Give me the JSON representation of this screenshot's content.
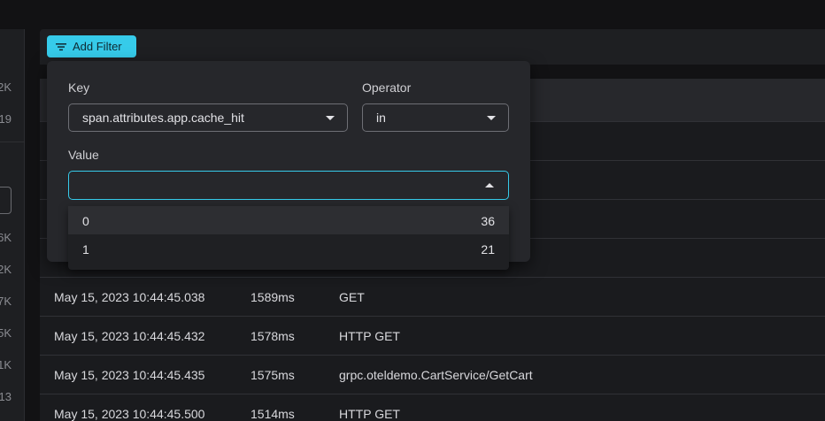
{
  "sidebar": {
    "counts": [
      "2K",
      "19",
      "6K",
      "2K",
      "7K",
      "5K",
      "1K",
      "13"
    ]
  },
  "filter_bar": {
    "add_filter_label": "Add Filter"
  },
  "filter_popover": {
    "key_label": "Key",
    "key_value": "span.attributes.app.cache_hit",
    "operator_label": "Operator",
    "operator_value": "in",
    "value_label": "Value",
    "value_input": "",
    "options": [
      {
        "value": "0",
        "count": "36"
      },
      {
        "value": "1",
        "count": "21"
      }
    ]
  },
  "table": {
    "rows": [
      {
        "time": "May 15, 2023 10:44:45.038",
        "duration": "1589ms",
        "name": "GET"
      },
      {
        "time": "May 15, 2023 10:44:45.432",
        "duration": "1578ms",
        "name": "HTTP GET"
      },
      {
        "time": "May 15, 2023 10:44:45.435",
        "duration": "1575ms",
        "name": "grpc.oteldemo.CartService/GetCart"
      },
      {
        "time": "May 15, 2023 10:44:45.500",
        "duration": "1514ms",
        "name": "HTTP GET"
      }
    ]
  },
  "colors": {
    "accent": "#36cbea",
    "background": "#121214",
    "panel": "#26272b"
  }
}
